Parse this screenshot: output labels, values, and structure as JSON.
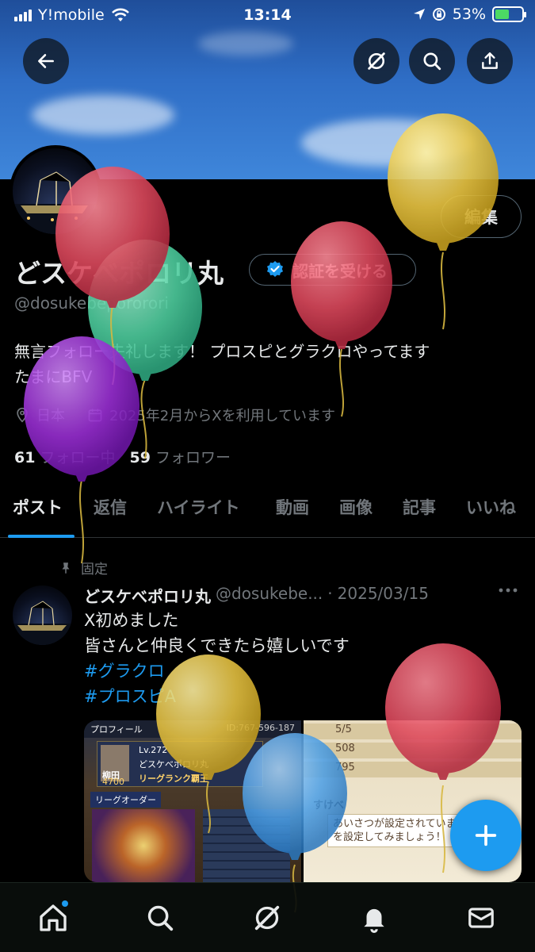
{
  "status_bar": {
    "carrier": "Y!mobile",
    "time": "13:14",
    "battery": "53%",
    "battery_level": 0.53
  },
  "header": {
    "back_icon": "arrow-left-icon",
    "grok_icon": "grok-icon",
    "search_icon": "search-icon",
    "share_icon": "share-icon"
  },
  "profile": {
    "edit_label": "編集",
    "display_name": "どスケべポロリ丸",
    "verify_label": "認証を受ける",
    "handle": "@dosukebepororori",
    "bio_line1": "無言フォロー失礼します！ プロスピとグラクロやってます",
    "bio_line2": "たまにBFV",
    "location": "日本",
    "joined": "2025年2月からXを利用しています",
    "following_count": "61",
    "following_label": "フォロー中",
    "followers_count": "59",
    "followers_label": "フォロワー"
  },
  "tabs": [
    {
      "label": "ポスト"
    },
    {
      "label": "返信"
    },
    {
      "label": "ハイライト"
    },
    {
      "label": "動画"
    },
    {
      "label": "画像"
    },
    {
      "label": "記事"
    },
    {
      "label": "いいね"
    }
  ],
  "pinned_post": {
    "pinned_label": "固定",
    "author_name": "どスケべポロリ丸",
    "author_handle": "@dosukebe...",
    "separator": "·",
    "date": "2025/03/15",
    "text_line1": "X初めました",
    "text_line2": "皆さんと仲良くできたら嬉しいです",
    "hashtag1": "#グラクロ",
    "hashtag2": "#プロスピA",
    "media_left": {
      "header": "プロフィール",
      "id": "ID:767-596-187",
      "level": "Lv.272",
      "player_name": "どスケべポロリ丸",
      "player": "柳田",
      "score": "4700",
      "rank": "リーグランク覇王",
      "order_title": "リーグオーダー"
    },
    "media_right": {
      "stat1": "5/5",
      "stat2": "508",
      "stat3": "795",
      "greeting_title": "すけべ",
      "greeting_line1": "あいさつが設定されていま",
      "greeting_line2": "を設定してみましょう！"
    }
  },
  "bottom_nav": [
    {
      "icon": "home-icon"
    },
    {
      "icon": "search-icon"
    },
    {
      "icon": "grok-icon"
    },
    {
      "icon": "notifications-icon"
    },
    {
      "icon": "messages-icon"
    }
  ],
  "colors": {
    "accent": "#1d9bf0",
    "background": "#000000",
    "muted": "#71767b",
    "text": "#e7e9ea",
    "balloon_red": "#e04a5e",
    "balloon_green": "#4fd0a0",
    "balloon_purple": "#9b2fd6",
    "balloon_yellow": "#e8c442",
    "balloon_blue": "#4a9ee6"
  }
}
